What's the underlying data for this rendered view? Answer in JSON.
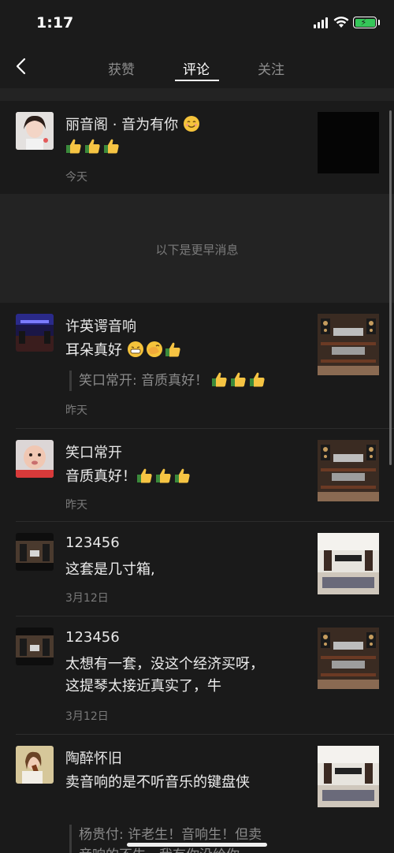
{
  "status_bar": {
    "time": "1:17"
  },
  "nav": {
    "tabs": [
      {
        "label": "获赞"
      },
      {
        "label": "评论"
      },
      {
        "label": "关注"
      }
    ]
  },
  "top_item": {
    "name": "丽音阁 · 音为有你",
    "date": "今天"
  },
  "earlier_label": "以下是更早消息",
  "comments": [
    {
      "name": "许英谔音响",
      "text": "耳朵真好",
      "quote": "笑口常开: 音质真好！",
      "date": "昨天"
    },
    {
      "name": "笑口常开",
      "text": "音质真好！",
      "date": "昨天"
    },
    {
      "name": "123456",
      "text": "这套是几寸箱,",
      "date": "3月12日"
    },
    {
      "name": "123456",
      "text_line1": "太想有一套，没这个经济买呀，",
      "text_line2": "这提琴太接近真实了，牛",
      "date": "3月12日"
    },
    {
      "name": "陶醉怀旧",
      "text": "卖音响的是不听音乐的键盘侠",
      "quote_line1": "杨贵付: 许老生！音响生！但卖",
      "quote_line2": "音响的不生，我有你没给你"
    }
  ],
  "colors": {
    "background": "#1a1a1a",
    "accent": "#ffffff",
    "secondary_text": "#7a7a7a"
  }
}
